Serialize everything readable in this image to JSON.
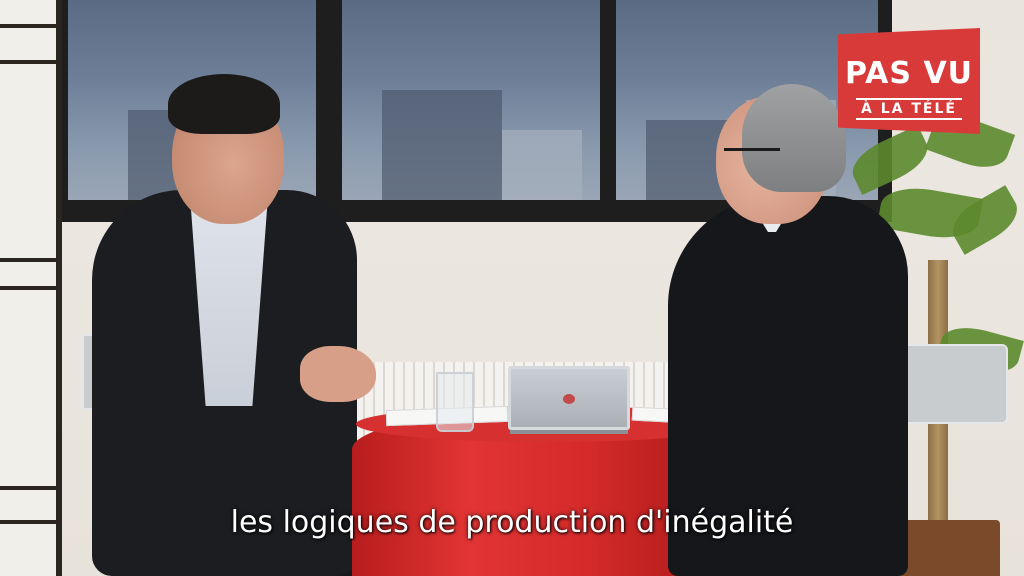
{
  "scene": {
    "description_icon": "interview-scene",
    "colors": {
      "logo_red": "#d83a3a",
      "table_red": "#d42a2a",
      "subtitle_text": "#ffffff"
    }
  },
  "logo": {
    "line1": "PAS VU",
    "line2": "À LA TÉLÉ"
  },
  "subtitle": {
    "text": "les logiques de production d'inégalité"
  }
}
